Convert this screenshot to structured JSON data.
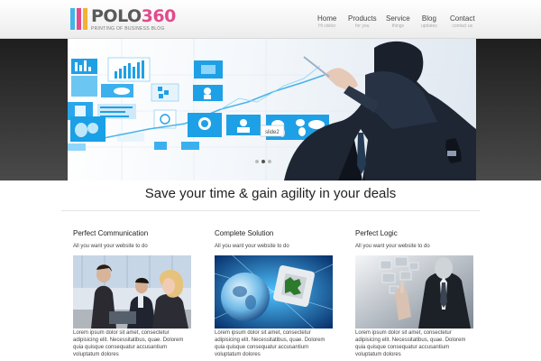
{
  "brand": {
    "name_text": "POLO",
    "name_number": "360",
    "tagline": "PRINTING OF BUSINESS BLOG",
    "bar_colors": [
      "#3fb6e8",
      "#e24b8c",
      "#f2b134"
    ]
  },
  "nav": {
    "items": [
      {
        "label": "Home",
        "sub": "Hi visitor"
      },
      {
        "label": "Products",
        "sub": "for you"
      },
      {
        "label": "Service",
        "sub": "things"
      },
      {
        "label": "Blog",
        "sub": "updates"
      },
      {
        "label": "Contact",
        "sub": "contact us"
      }
    ]
  },
  "slider": {
    "badge_text": "slide2",
    "dots": 3,
    "active_dot": 1
  },
  "tagline": "Save your time & gain agility in your deals",
  "columns": [
    {
      "title": "Perfect Communication",
      "subtitle": "All you want your website to do",
      "body": "Lorem ipsum dolor sit amet, consectetur adipisicing elit. Necessitatibus, quae. Dolorem quia quisque consequatur accusantium voluptatum dolores",
      "image": "business-team-photo"
    },
    {
      "title": "Complete Solution",
      "subtitle": "All you want your website to do",
      "body": "Lorem ipsum dolor sit amet, consectetur adipisicing elit. Necessitatibus, quae. Dolorem quia quisque consequatur accusantium voluptatum dolores",
      "image": "globe-and-chip-photo"
    },
    {
      "title": "Perfect Logic",
      "subtitle": "All you want your website to do",
      "body": "Lorem ipsum dolor sit amet, consectetur adipisicing elit. Necessitatibus, quae. Dolorem quia quisque consequatur accusantium voluptatum dolores",
      "image": "touchscreen-businessman-photo"
    }
  ],
  "colors": {
    "accent_blue": "#1ea0e6",
    "logo_pink": "#e24b8c",
    "dark_band": "#2a2a2a"
  }
}
